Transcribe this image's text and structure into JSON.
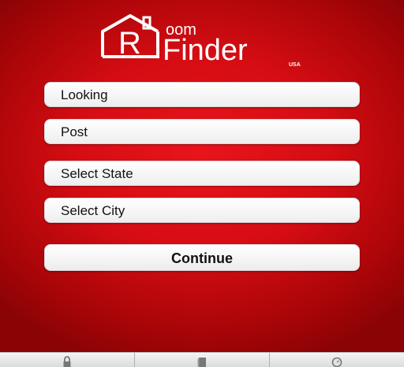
{
  "app": {
    "logo_letter": "R",
    "logo_word1": "oom",
    "logo_word2": "Finder",
    "logo_region": "USA"
  },
  "menu": {
    "looking_label": "Looking",
    "post_label": "Post",
    "state_label": "Select State",
    "city_label": "Select City",
    "continue_label": "Continue"
  },
  "bottom_tabs": [
    {
      "icon": "lock-icon"
    },
    {
      "icon": "document-icon"
    },
    {
      "icon": "clock-icon"
    }
  ],
  "colors": {
    "background": "#d50d13",
    "logo": "#ffffff"
  }
}
